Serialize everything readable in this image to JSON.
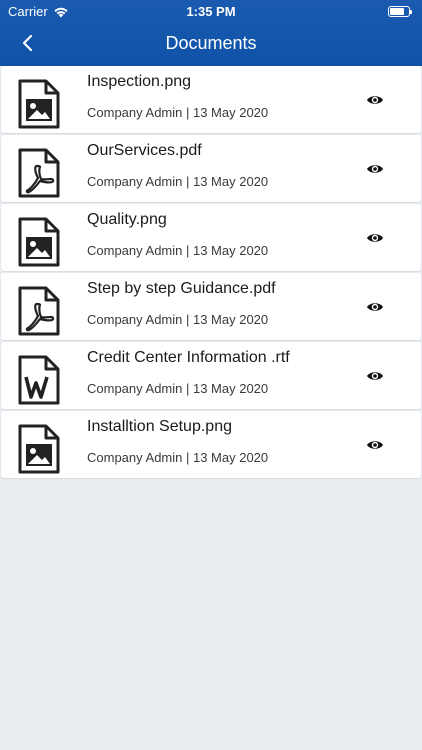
{
  "status_bar": {
    "carrier": "Carrier",
    "time": "1:35 PM"
  },
  "header": {
    "title": "Documents",
    "back_icon": "chevron-left-icon"
  },
  "colors": {
    "header": "#1a5bb0",
    "background": "#e9edf1",
    "card": "#ffffff",
    "icon": "#222222"
  },
  "documents": [
    {
      "name": "Inspection.png",
      "meta": "Company Admin | 13 May 2020",
      "icon": "image-file-icon"
    },
    {
      "name": "OurServices.pdf",
      "meta": "Company Admin | 13 May 2020",
      "icon": "pdf-file-icon"
    },
    {
      "name": "Quality.png",
      "meta": "Company Admin | 13 May 2020",
      "icon": "image-file-icon"
    },
    {
      "name": "Step by step Guidance.pdf",
      "meta": "Company Admin | 13 May 2020",
      "icon": "pdf-file-icon"
    },
    {
      "name": "Credit Center Information .rtf",
      "meta": "Company Admin | 13 May 2020",
      "icon": "word-file-icon"
    },
    {
      "name": "Installtion Setup.png",
      "meta": "Company Admin | 13 May 2020",
      "icon": "image-file-icon"
    }
  ]
}
